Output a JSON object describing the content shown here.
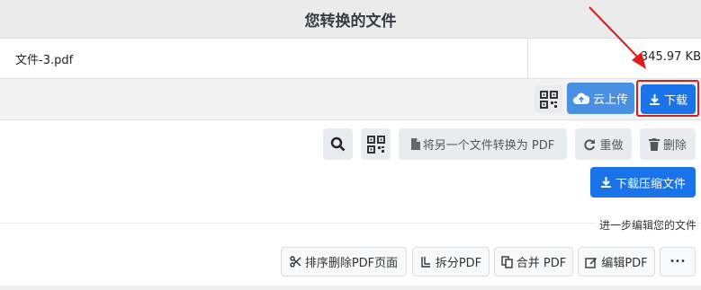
{
  "header": {
    "title": "您转换的文件"
  },
  "file": {
    "name": "文件-3.pdf",
    "size": "345.97 KB"
  },
  "actions": {
    "cloud_upload": "云上传",
    "download": "下载"
  },
  "toolbar": {
    "convert_another": "将另一个文件转换为 PDF",
    "redo": "重做",
    "delete": "删除",
    "download_zip": "下载压缩文件"
  },
  "edit": {
    "caption": "进一步编辑您的文件",
    "reorder": "排序删除PDF页面",
    "split": "拆分PDF",
    "merge": "合并 PDF",
    "edit_pdf": "编辑PDF",
    "more": "•••"
  },
  "colors": {
    "primary": "#1a73e8",
    "secondary": "#4a90e2",
    "highlight": "#e01b1b"
  },
  "icons": [
    "qr-code-icon",
    "cloud-upload-icon",
    "download-icon",
    "search-icon",
    "file-icon",
    "redo-icon",
    "trash-icon",
    "scissors-icon",
    "split-icon",
    "copy-icon",
    "edit-icon",
    "arrow-icon"
  ]
}
